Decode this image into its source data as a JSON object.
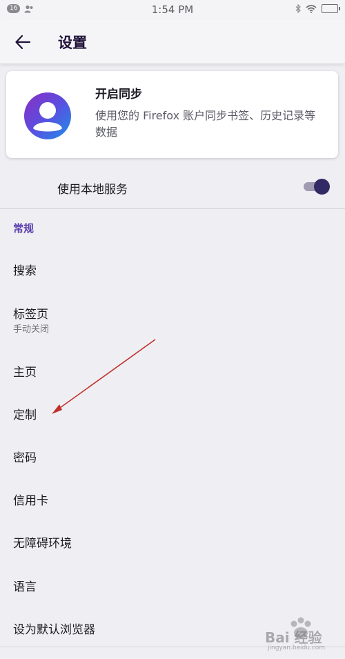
{
  "status_bar": {
    "badge": "16",
    "time": "1:54 PM"
  },
  "toolbar": {
    "back_icon": "arrow-left-icon",
    "title": "设置"
  },
  "sync_card": {
    "title": "开启同步",
    "description": "使用您的 Firefox 账户同步书签、历史记录等数据",
    "avatar_icon": "account-avatar-icon"
  },
  "local_service": {
    "label": "使用本地服务",
    "enabled": true
  },
  "section": {
    "general": "常规"
  },
  "items": [
    {
      "label": "搜索"
    },
    {
      "label": "标签页",
      "sublabel": "手动关闭"
    },
    {
      "label": "主页"
    },
    {
      "label": "定制"
    },
    {
      "label": "密码"
    },
    {
      "label": "信用卡"
    },
    {
      "label": "无障碍环境"
    },
    {
      "label": "语言"
    },
    {
      "label": "设为默认浏览器"
    }
  ],
  "watermark": {
    "text": "Bai 经验",
    "sub": "jingyan.baidu.com"
  },
  "colors": {
    "accent": "#5b3fae",
    "toggle_knob": "#312a65",
    "background": "#efeff3",
    "annotation_arrow": "#c0302c"
  }
}
